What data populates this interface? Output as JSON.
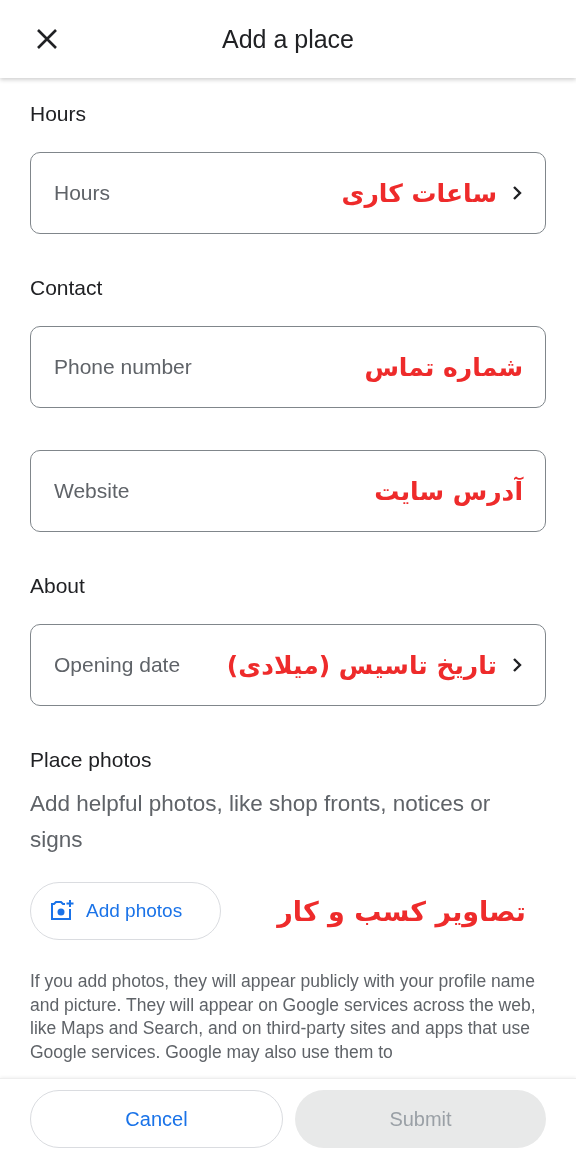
{
  "header": {
    "title": "Add a place"
  },
  "sections": [
    {
      "heading": "Hours",
      "fields": [
        {
          "kind": "nav",
          "placeholder": "Hours",
          "note": "ساعات کاری"
        }
      ]
    },
    {
      "heading": "Contact",
      "fields": [
        {
          "kind": "text",
          "placeholder": "Phone number",
          "note": "شماره تماس"
        },
        {
          "kind": "text",
          "placeholder": "Website",
          "note": "آدرس سایت"
        }
      ]
    },
    {
      "heading": "About",
      "fields": [
        {
          "kind": "nav",
          "placeholder": "Opening date",
          "note": "تاریخ تاسیس (میلادی)"
        }
      ]
    }
  ],
  "photos": {
    "heading": "Place photos",
    "description": "Add helpful photos, like shop fronts, notices or signs",
    "button": "Add photos",
    "note": "تصاویر کسب و کار",
    "disclaimer": "If you add photos, they will appear publicly with your profile name and picture. They will appear on Google services across the web, like Maps and Search, and on third-party sites and apps that use Google services. Google may also use them to"
  },
  "footer": {
    "buttons": [
      {
        "label": "Cancel",
        "disabled": false
      },
      {
        "label": "Submit",
        "disabled": true
      }
    ]
  }
}
